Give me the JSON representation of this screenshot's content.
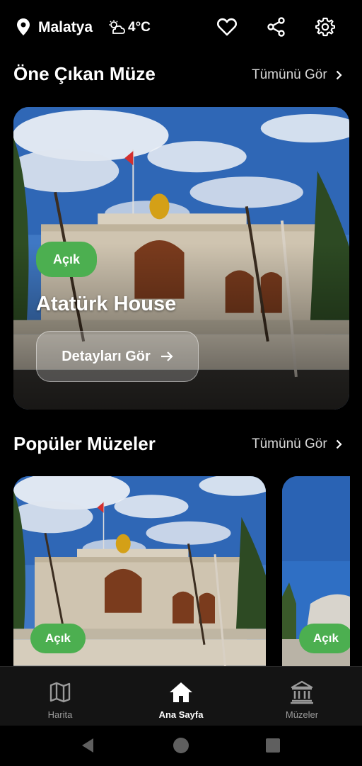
{
  "header": {
    "city": "Malatya",
    "temperature": "4°C",
    "icons": [
      "location-pin-icon",
      "weather-icon",
      "heart-icon",
      "share-icon",
      "settings-icon"
    ]
  },
  "featured": {
    "section_title": "Öne Çıkan Müze",
    "see_all": "Tümünü Gör",
    "status": "Açık",
    "name": "Atatürk House",
    "details_button": "Detayları Gör"
  },
  "popular": {
    "section_title": "Popüler Müzeler",
    "see_all": "Tümünü Gör",
    "cards": [
      {
        "status": "Açık"
      },
      {
        "status": "Açık"
      }
    ]
  },
  "bottom_nav": {
    "items": [
      {
        "label": "Harita",
        "icon": "map-icon",
        "active": false
      },
      {
        "label": "Ana Sayfa",
        "icon": "home-icon",
        "active": true
      },
      {
        "label": "Müzeler",
        "icon": "museum-icon",
        "active": false
      }
    ]
  },
  "colors": {
    "background": "#000000",
    "accent_green": "#4caf50",
    "nav_background": "#141414"
  }
}
